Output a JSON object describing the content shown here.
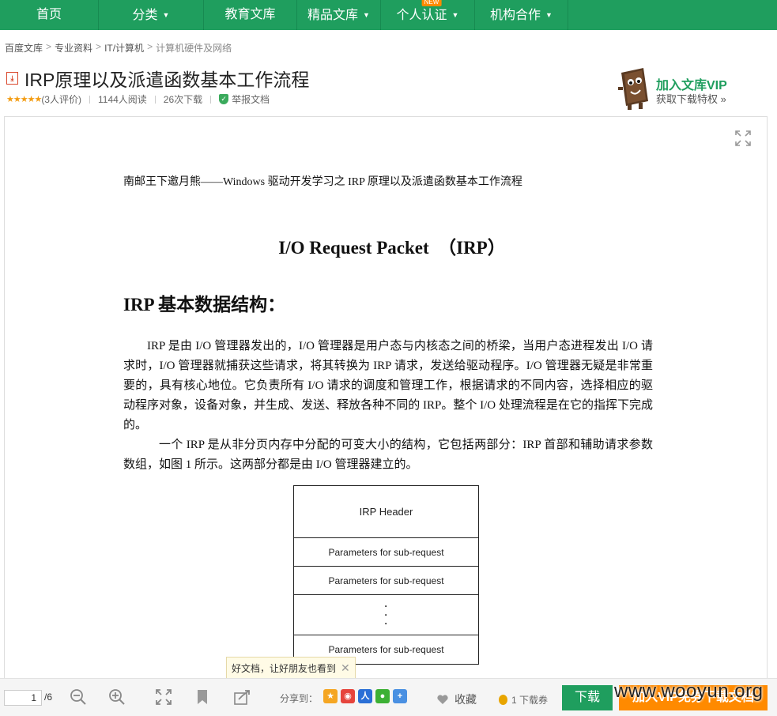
{
  "nav": {
    "items": [
      {
        "label": "首页"
      },
      {
        "label": "分类"
      },
      {
        "label": "教育文库"
      },
      {
        "label": "精品文库"
      },
      {
        "label": "个人认证",
        "badge": "NEW"
      },
      {
        "label": "机构合作"
      }
    ],
    "background": "#1f9e5e"
  },
  "breadcrumb": [
    "百度文库",
    "专业资料",
    "IT/计算机",
    "计算机硬件及网络"
  ],
  "document": {
    "title": "IRP原理以及派遣函数基本工作流程",
    "file_type_icon": "pdf-icon",
    "rating_count": "(3人评价)",
    "reads": "1144人阅读",
    "downloads": "26次下载",
    "report_label": "举报文档"
  },
  "vip_promo": {
    "title": "加入文库VIP",
    "subtitle": "获取下载特权 »"
  },
  "page": {
    "header_line": "南邮王下邀月熊——Windows 驱动开发学习之 IRP 原理以及派遣函数基本工作流程",
    "main_title": "I/O Request Packet　（IRP）",
    "section_title": "IRP 基本数据结构：",
    "paragraph1": "IRP 是由 I/O 管理器发出的，I/O 管理器是用户态与内核态之间的桥梁，当用户态进程发出 I/O 请求时，I/O 管理器就捕获这些请求，将其转换为 IRP 请求，发送给驱动程序。I/O 管理器无疑是非常重要的，具有核心地位。它负责所有 I/O 请求的调度和管理工作，根据请求的不同内容，选择相应的驱动程序对象，设备对象，并生成、发送、释放各种不同的 IRP。整个 I/O 处理流程是在它的指挥下完成的。",
    "paragraph2": "一个 IRP 是从非分页内存中分配的可变大小的结构，它包括两部分：IRP 首部和辅助请求参数数组，如图 1 所示。这两部分都是由 I/O 管理器建立的。",
    "diagram": {
      "header": "IRP Header",
      "param_1": "Parameters for sub-request",
      "param_2": "Parameters for sub-request",
      "param_last": "Parameters for sub-request"
    }
  },
  "share_tip": "好文档，让好朋友也看到",
  "toolbar": {
    "current_page": "1",
    "total_pages": "/6",
    "share_label": "分享到：",
    "favorite_label": "收藏",
    "voucher_label": "1 下载券",
    "download_label": "下载",
    "vip_download_label": "加入VIP免券下载文档"
  },
  "watermark": "www.wooyun.org"
}
